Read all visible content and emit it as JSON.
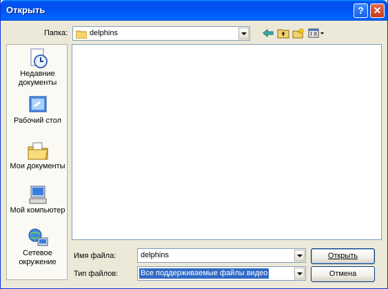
{
  "window": {
    "title": "Открыть"
  },
  "toolbar": {
    "lookin_label": "Папка:",
    "lookin_value": "delphins"
  },
  "places": [
    {
      "label": "Недавние документы",
      "icon": "recent-documents-icon"
    },
    {
      "label": "Рабочий стол",
      "icon": "desktop-icon"
    },
    {
      "label": "Мои документы",
      "icon": "my-documents-icon"
    },
    {
      "label": "Мой компьютер",
      "icon": "my-computer-icon"
    },
    {
      "label": "Сетевое окружение",
      "icon": "network-places-icon"
    }
  ],
  "filename": {
    "label": "Имя файла:",
    "value": "delphins"
  },
  "filetype": {
    "label": "Тип файлов:",
    "value": "Все поддерживаемые файлы видео"
  },
  "buttons": {
    "open": "Открыть",
    "cancel": "Отмена"
  }
}
